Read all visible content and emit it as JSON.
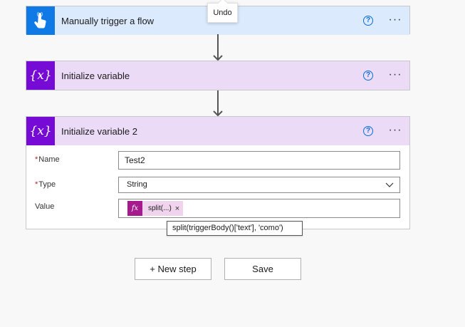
{
  "trigger_card": {
    "title": "Manually trigger a flow",
    "help": "?",
    "more": "···"
  },
  "init_var_card": {
    "icon_text": "{x}",
    "title": "Initialize variable",
    "help": "?",
    "more": "···"
  },
  "init_var2_card": {
    "icon_text": "{x}",
    "title": "Initialize variable 2",
    "help": "?",
    "more": "···",
    "fields": {
      "name": {
        "required_mark": "*",
        "label": "Name",
        "value": "Test2"
      },
      "type": {
        "required_mark": "*",
        "label": "Type",
        "value": "String"
      },
      "value": {
        "label": "Value",
        "token": {
          "icon_text": "fx",
          "text": "split(...)",
          "remove": "×"
        }
      }
    }
  },
  "expression_tooltip": "split(triggerBody()['text'], 'como')",
  "undo_tooltip": "Undo",
  "buttons": {
    "new_step": "+ New step",
    "save": "Save"
  },
  "colors": {
    "trigger_header": "#dceafe",
    "trigger_icon": "#0f7ae5",
    "variable_header": "#ebdbf7",
    "variable_icon": "#770bd6",
    "expression_token": "#a51a8d",
    "help_icon": "#0a6ed1"
  },
  "icons": {
    "trigger": "hand-touch-icon",
    "variable": "variable-braces-icon",
    "help": "question-circle-icon",
    "more": "ellipsis-icon",
    "type_dropdown": "chevron-down-icon",
    "expression": "function-fx-icon",
    "connector": "arrow-down-icon"
  }
}
